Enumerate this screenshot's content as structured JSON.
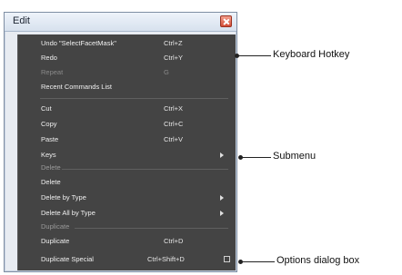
{
  "window": {
    "title": "Edit",
    "close_icon": "close-icon"
  },
  "menu": {
    "items": [
      {
        "label": "Undo \"SelectFacetMask\"",
        "hotkey": "Ctrl+Z",
        "enabled": true
      },
      {
        "label": "Redo",
        "hotkey": "Ctrl+Y",
        "enabled": true
      },
      {
        "label": "Repeat",
        "hotkey": "G",
        "enabled": false
      },
      {
        "label": "Recent Commands List",
        "hotkey": "",
        "enabled": true
      },
      {
        "label": "Cut",
        "hotkey": "Ctrl+X",
        "enabled": true
      },
      {
        "label": "Copy",
        "hotkey": "Ctrl+C",
        "enabled": true
      },
      {
        "label": "Paste",
        "hotkey": "Ctrl+V",
        "enabled": true
      },
      {
        "label": "Keys",
        "hotkey": "",
        "enabled": true,
        "submenu": true
      },
      {
        "label": "Delete",
        "section": true
      },
      {
        "label": "Delete",
        "hotkey": "",
        "enabled": true
      },
      {
        "label": "Delete by Type",
        "hotkey": "",
        "enabled": true,
        "submenu": true
      },
      {
        "label": "Delete All by Type",
        "hotkey": "",
        "enabled": true,
        "submenu": true
      },
      {
        "label": "Duplicate",
        "section": true
      },
      {
        "label": "Duplicate",
        "hotkey": "Ctrl+D",
        "enabled": true
      },
      {
        "label": "Duplicate Special",
        "hotkey": "Ctrl+Shift+D",
        "enabled": true,
        "options_box": true
      }
    ]
  },
  "callouts": {
    "hotkey": "Keyboard Hotkey",
    "submenu": "Submenu",
    "options": "Options dialog box"
  }
}
